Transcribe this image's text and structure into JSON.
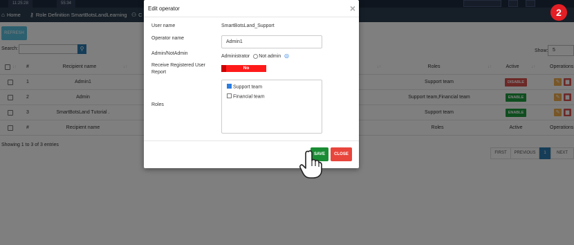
{
  "topbar": {
    "clock_left": "11:25:28",
    "clock_right": "55:34"
  },
  "tabs": [
    {
      "icon": "home-icon",
      "label": "Home"
    },
    {
      "icon": "key-icon",
      "label": "Role Definition SmartBotsLandLearning"
    },
    {
      "icon": "users-icon",
      "label": "C"
    }
  ],
  "step": "2",
  "toolbar": {
    "refresh": "REFRESH",
    "search_label": "Search:",
    "show_label": "Show:",
    "show_value": "5"
  },
  "table": {
    "columns": [
      "#",
      "Recipient name",
      "Roles",
      "Active",
      "Operations"
    ],
    "rows": [
      {
        "num": "1",
        "name": "Admin1",
        "roles": "Support team",
        "status": "DISABLE"
      },
      {
        "num": "2",
        "name": "Admin",
        "roles": "Support team,Financial team",
        "status": "ENABLE"
      },
      {
        "num": "3",
        "name": "SmartBotsLand Tutorial .",
        "roles": "Support team",
        "status": "ENABLE"
      }
    ],
    "footer": [
      "#",
      "Recipient name",
      "Roles",
      "Active",
      "Operations"
    ]
  },
  "entries": "Showing 1 to 3 of 3 entries",
  "pagination": {
    "first": "FIRST",
    "previous": "PREVIOUS",
    "current": "1",
    "next": "NEXT"
  },
  "modal": {
    "title": "Edit operator",
    "close": "×",
    "user_name_label": "User name",
    "user_name": "SmartBotsLand_Support",
    "operator_name_label": "Operator name",
    "operator_name": "Admin1",
    "admin_label": "Admin/NotAdmin",
    "opt_admin": "Administrator",
    "opt_not_admin": "Not admin",
    "report_label": "Receive Registered User Report",
    "report_value": "No",
    "roles_label": "Roles",
    "roles": [
      {
        "label": "Support team",
        "checked": true
      },
      {
        "label": "Financial team",
        "checked": false
      }
    ],
    "save": "SAVE",
    "close_btn": "CLOSE"
  }
}
